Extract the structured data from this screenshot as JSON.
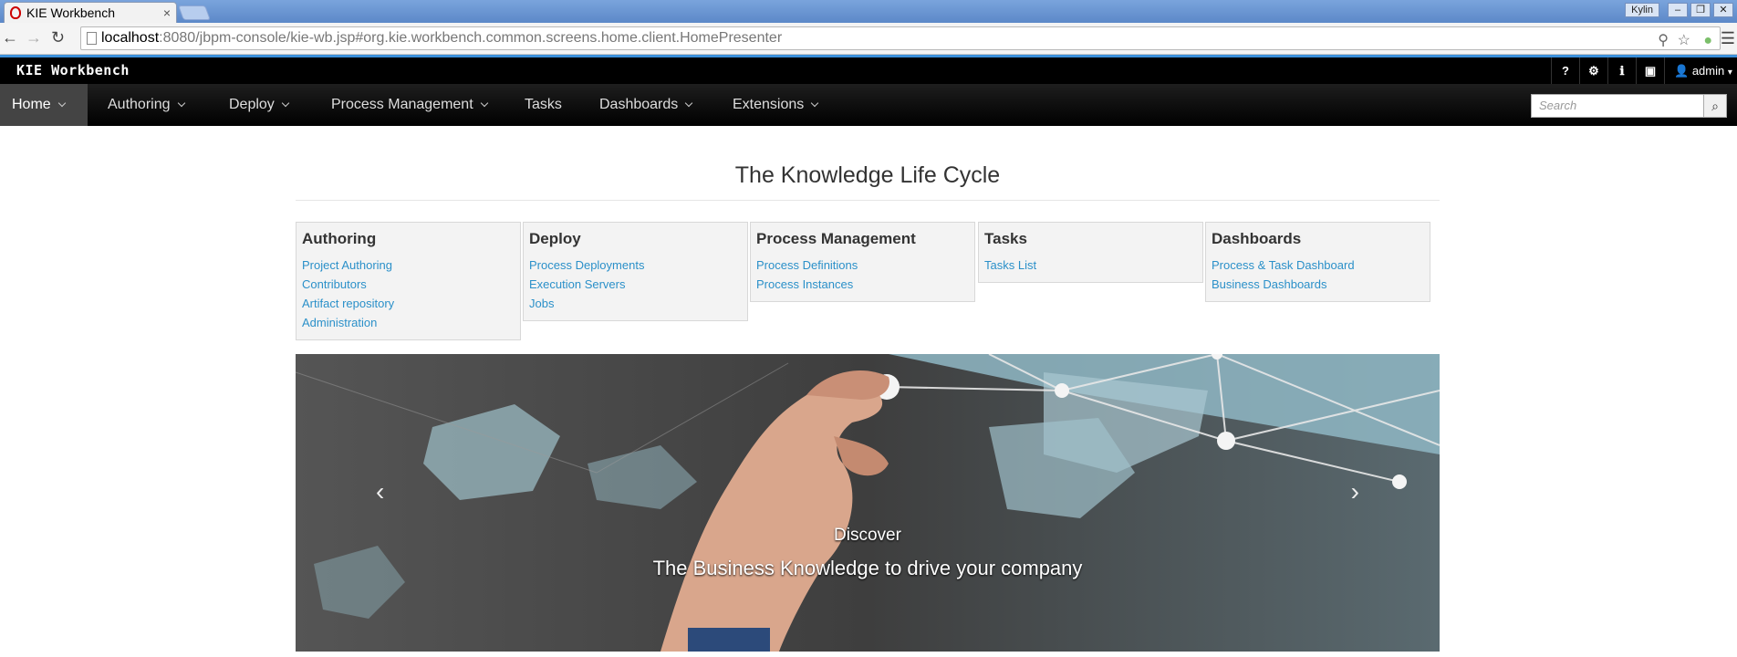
{
  "browser": {
    "tab_title": "KIE Workbench",
    "tab_close": "×",
    "user_badge": "Kylin",
    "url_host": "localhost",
    "url_rest": ":8080/jbpm-console/kie-wb.jsp#org.kie.workbench.common.screens.home.client.HomePresenter"
  },
  "app": {
    "brand": "KIE Workbench",
    "utils": [
      "?",
      "⚙",
      "ℹ",
      "▣"
    ],
    "user": "admin",
    "nav": [
      {
        "label": "Home",
        "dropdown": true,
        "active": true
      },
      {
        "label": "Authoring",
        "dropdown": true
      },
      {
        "label": "Deploy",
        "dropdown": true
      },
      {
        "label": "Process Management",
        "dropdown": true
      },
      {
        "label": "Tasks",
        "dropdown": false
      },
      {
        "label": "Dashboards",
        "dropdown": true
      },
      {
        "label": "Extensions",
        "dropdown": true
      }
    ],
    "search_placeholder": "Search"
  },
  "main": {
    "title": "The Knowledge Life Cycle",
    "panels": [
      {
        "title": "Authoring",
        "links": [
          "Project Authoring",
          "Contributors",
          "Artifact repository",
          "Administration"
        ]
      },
      {
        "title": "Deploy",
        "links": [
          "Process Deployments",
          "Execution Servers",
          "Jobs"
        ]
      },
      {
        "title": "Process Management",
        "links": [
          "Process Definitions",
          "Process Instances"
        ]
      },
      {
        "title": "Tasks",
        "links": [
          "Tasks List"
        ]
      },
      {
        "title": "Dashboards",
        "links": [
          "Process & Task Dashboard",
          "Business Dashboards"
        ]
      }
    ],
    "carousel": {
      "caption_title": "Discover",
      "caption_text": "The Business Knowledge to drive your company",
      "prev": "‹",
      "next": "›"
    }
  },
  "colors": {
    "link": "#2b90c9",
    "accent_line": "#3b8fd9",
    "nav_bg": "#000000"
  }
}
